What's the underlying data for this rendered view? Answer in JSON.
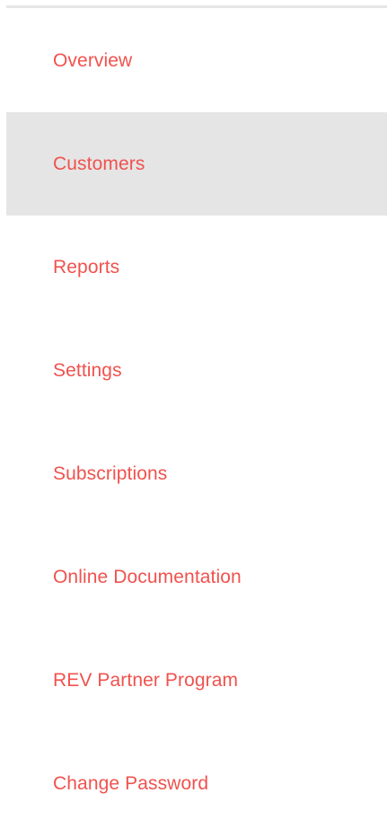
{
  "theme": {
    "link_color": "#f0524e",
    "active_background": "#e5e5e5",
    "divider_color": "#e6e6e6"
  },
  "nav": {
    "active_index": 1,
    "items": [
      {
        "label": "Overview"
      },
      {
        "label": "Customers"
      },
      {
        "label": "Reports"
      },
      {
        "label": "Settings"
      },
      {
        "label": "Subscriptions"
      },
      {
        "label": "Online Documentation"
      },
      {
        "label": "REV Partner Program"
      },
      {
        "label": "Change Password"
      }
    ]
  }
}
